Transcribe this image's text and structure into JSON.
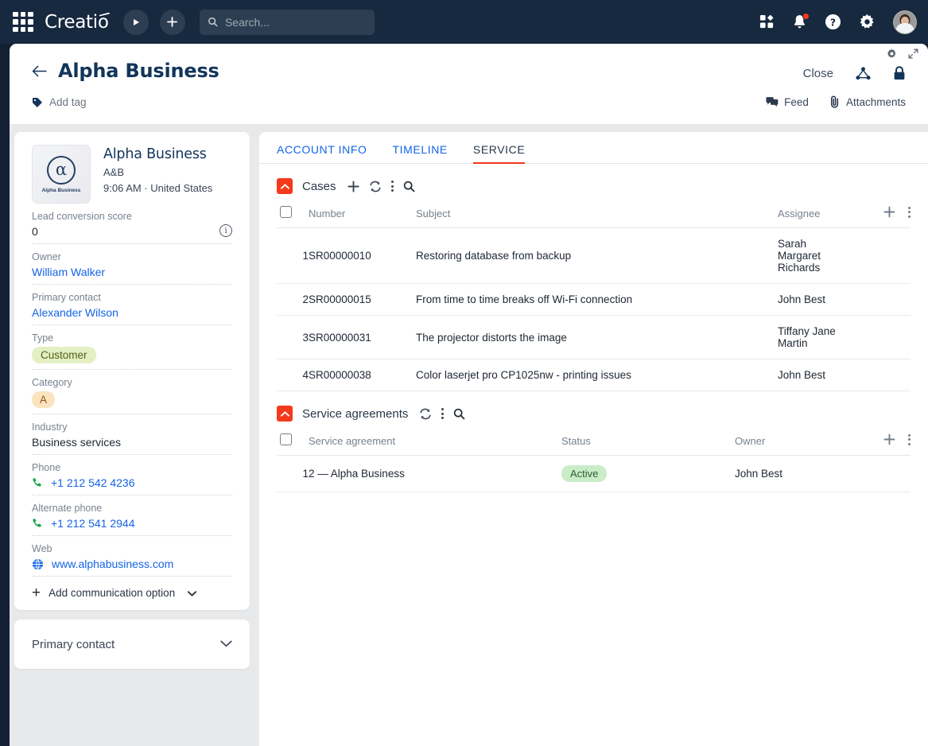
{
  "topbar": {
    "brand": "Creatio",
    "search_placeholder": "Search...",
    "search_value": "",
    "icons": {
      "apps": "apps-grid-icon",
      "play": "play-icon",
      "add": "plus-icon",
      "search": "search-icon",
      "marketplace": "marketplace-icon",
      "notifications": "bell-icon",
      "help": "help-circle-icon",
      "settings": "gear-icon",
      "avatar": "user-avatar"
    }
  },
  "record_header": {
    "back": "back-arrow-icon",
    "title": "Alpha Business",
    "add_tag_label": "Add tag",
    "close_label": "Close",
    "share_icon": "share-nodes-icon",
    "lock_icon": "lock-icon",
    "gear_icon": "gear-icon",
    "expand_icon": "expand-icon",
    "feed_label": "Feed",
    "attachments_label": "Attachments"
  },
  "profile": {
    "logo_glyph": "α",
    "logo_caption": "Alpha Business",
    "name": "Alpha Business",
    "alias": "A&B",
    "local_time": "9:06 AM · United States",
    "fields": [
      {
        "label": "Lead conversion score",
        "value": "0",
        "kind": "text",
        "info": true
      },
      {
        "label": "Owner",
        "value": "William Walker",
        "kind": "link"
      },
      {
        "label": "Primary contact",
        "value": "Alexander Wilson",
        "kind": "link"
      },
      {
        "label": "Type",
        "value": "Customer",
        "kind": "badge-customer"
      },
      {
        "label": "Category",
        "value": "A",
        "kind": "badge-cat"
      },
      {
        "label": "Industry",
        "value": "Business services",
        "kind": "text"
      },
      {
        "label": "Phone",
        "value": "+1 212 542 4236",
        "kind": "phone"
      },
      {
        "label": "Alternate phone",
        "value": "+1 212 541 2944",
        "kind": "phone"
      },
      {
        "label": "Web",
        "value": "www.alphabusiness.com",
        "kind": "web"
      }
    ],
    "add_communication_label": "Add communication option"
  },
  "primary_contact_card": {
    "title": "Primary contact"
  },
  "tabs": [
    {
      "label": "ACCOUNT INFO",
      "active": false
    },
    {
      "label": "TIMELINE",
      "active": false
    },
    {
      "label": "SERVICE",
      "active": true
    }
  ],
  "cases": {
    "title": "Cases",
    "tools": [
      "plus-icon",
      "refresh-icon",
      "kebab-icon",
      "search-icon"
    ],
    "columns": [
      "Number",
      "Subject",
      "Assignee"
    ],
    "rows": [
      {
        "index": "1",
        "number": "SR00000010",
        "subject": "Restoring database from backup",
        "assignee": "Sarah Margaret Richards"
      },
      {
        "index": "2",
        "number": "SR00000015",
        "subject": "From time to time breaks off Wi-Fi connection",
        "assignee": "John Best"
      },
      {
        "index": "3",
        "number": "SR00000031",
        "subject": "The projector distorts the image",
        "assignee": "Tiffany Jane Martin"
      },
      {
        "index": "4",
        "number": "SR00000038",
        "subject": "Color laserjet pro CP1025nw - printing issues",
        "assignee": "John Best"
      }
    ]
  },
  "service_agreements": {
    "title": "Service agreements",
    "tools": [
      "refresh-icon",
      "kebab-icon",
      "search-icon"
    ],
    "columns": [
      "Service agreement",
      "Status",
      "Owner"
    ],
    "rows": [
      {
        "index": "1",
        "agreement": "2 — Alpha Business",
        "status": "Active",
        "owner": "John Best"
      }
    ]
  },
  "colors": {
    "accent": "#f5391c",
    "link": "#1464e6",
    "topbar": "#17293f",
    "page_bg": "#e8e9ea",
    "badge_customer_bg": "#e4efc3",
    "badge_category_bg": "#fce3bf",
    "badge_active_bg": "#c9ecc9"
  }
}
